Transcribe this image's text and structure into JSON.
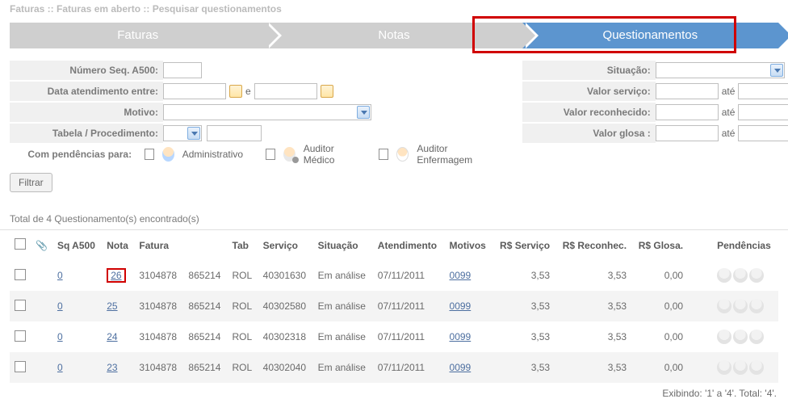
{
  "breadcrumb": "Faturas :: Faturas em aberto :: Pesquisar questionamentos",
  "tabs": {
    "faturas": "Faturas",
    "notas": "Notas",
    "questionamentos": "Questionamentos"
  },
  "filters": {
    "numseq": "Número Seq. A500:",
    "dataentre": "Data atendimento entre:",
    "e": "e",
    "motivo": "Motivo:",
    "tabproc": "Tabela / Procedimento:",
    "compend": "Com pendências para:",
    "situacao": "Situação:",
    "valservico": "Valor serviço:",
    "valrec": "Valor reconhecido:",
    "valglosa": "Valor glosa :",
    "ate": "até",
    "admin": "Administrativo",
    "medico": "Auditor Médico",
    "enf": "Auditor Enfermagem",
    "filtrar": "Filtrar"
  },
  "resultmsg": "Total de 4 Questionamento(s) encontrado(s)",
  "headers": {
    "sq": "Sq A500",
    "nota": "Nota",
    "fatura": "Fatura",
    "tab": "Tab",
    "servico": "Serviço",
    "situacao": "Situação",
    "atend": "Atendimento",
    "motivos": "Motivos",
    "rsserv": "R$ Serviço",
    "rsrec": "R$ Reconhec.",
    "rsglosa": "R$ Glosa.",
    "pend": "Pendências"
  },
  "rows": [
    {
      "sq": "0",
      "nota": "26",
      "hl": true,
      "fatura": "3104878",
      "fat2": "865214",
      "tab": "ROL",
      "servico": "40301630",
      "sit": "Em análise",
      "atend": "07/11/2011",
      "motivo": "0099",
      "rsserv": "3,53",
      "rsrec": "3,53",
      "rsglo": "0,00"
    },
    {
      "sq": "0",
      "nota": "25",
      "hl": false,
      "fatura": "3104878",
      "fat2": "865214",
      "tab": "ROL",
      "servico": "40302580",
      "sit": "Em análise",
      "atend": "07/11/2011",
      "motivo": "0099",
      "rsserv": "3,53",
      "rsrec": "3,53",
      "rsglo": "0,00"
    },
    {
      "sq": "0",
      "nota": "24",
      "hl": false,
      "fatura": "3104878",
      "fat2": "865214",
      "tab": "ROL",
      "servico": "40302318",
      "sit": "Em análise",
      "atend": "07/11/2011",
      "motivo": "0099",
      "rsserv": "3,53",
      "rsrec": "3,53",
      "rsglo": "0,00"
    },
    {
      "sq": "0",
      "nota": "23",
      "hl": false,
      "fatura": "3104878",
      "fat2": "865214",
      "tab": "ROL",
      "servico": "40302040",
      "sit": "Em análise",
      "atend": "07/11/2011",
      "motivo": "0099",
      "rsserv": "3,53",
      "rsrec": "3,53",
      "rsglo": "0,00"
    }
  ],
  "footer": "Exibindo: '1' a '4'. Total: '4'."
}
